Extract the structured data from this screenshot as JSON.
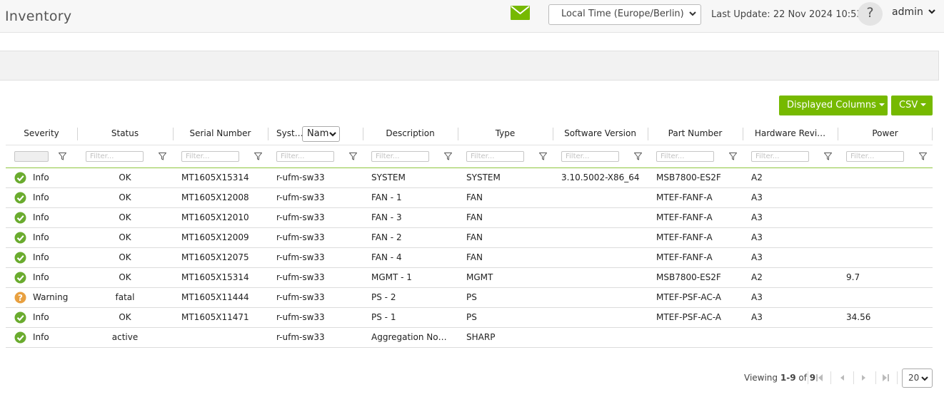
{
  "header": {
    "title": "Inventory",
    "timezone": "Local Time (Europe/Berlin)",
    "last_update_label": "Last Update:",
    "last_update_value": "22 Nov 2024 10:53",
    "help_symbol": "?",
    "user": "admin",
    "icons": [
      "mail-icon",
      "chevron-down-icon"
    ]
  },
  "toolbar": {
    "displayed_columns_label": "Displayed Columns",
    "csv_label": "CSV"
  },
  "colors": {
    "accent": "#76b900",
    "info": "#6aab2e",
    "warning": "#e8a040"
  },
  "table": {
    "columns": [
      "Severity",
      "Status",
      "Serial Number",
      "Syst…",
      "Description",
      "Type",
      "Software Version",
      "Part Number",
      "Hardware Revi…",
      "Power"
    ],
    "system_selector_value": "Nam",
    "filter_placeholder": "Filter...",
    "rows": [
      {
        "severity": "Info",
        "status": "OK",
        "serial": "MT1605X15314",
        "system": "r-ufm-sw33",
        "description": "SYSTEM",
        "type": "SYSTEM",
        "sw_version": "3.10.5002-X86_64",
        "part_number": "MSB7800-ES2F",
        "hw_rev": "A2",
        "power": ""
      },
      {
        "severity": "Info",
        "status": "OK",
        "serial": "MT1605X12008",
        "system": "r-ufm-sw33",
        "description": "FAN - 1",
        "type": "FAN",
        "sw_version": "",
        "part_number": "MTEF-FANF-A",
        "hw_rev": "A3",
        "power": ""
      },
      {
        "severity": "Info",
        "status": "OK",
        "serial": "MT1605X12010",
        "system": "r-ufm-sw33",
        "description": "FAN - 3",
        "type": "FAN",
        "sw_version": "",
        "part_number": "MTEF-FANF-A",
        "hw_rev": "A3",
        "power": ""
      },
      {
        "severity": "Info",
        "status": "OK",
        "serial": "MT1605X12009",
        "system": "r-ufm-sw33",
        "description": "FAN - 2",
        "type": "FAN",
        "sw_version": "",
        "part_number": "MTEF-FANF-A",
        "hw_rev": "A3",
        "power": ""
      },
      {
        "severity": "Info",
        "status": "OK",
        "serial": "MT1605X12075",
        "system": "r-ufm-sw33",
        "description": "FAN - 4",
        "type": "FAN",
        "sw_version": "",
        "part_number": "MTEF-FANF-A",
        "hw_rev": "A3",
        "power": ""
      },
      {
        "severity": "Info",
        "status": "OK",
        "serial": "MT1605X15314",
        "system": "r-ufm-sw33",
        "description": "MGMT - 1",
        "type": "MGMT",
        "sw_version": "",
        "part_number": "MSB7800-ES2F",
        "hw_rev": "A2",
        "power": "9.7"
      },
      {
        "severity": "Warning",
        "status": "fatal",
        "serial": "MT1605X11444",
        "system": "r-ufm-sw33",
        "description": "PS - 2",
        "type": "PS",
        "sw_version": "",
        "part_number": "MTEF-PSF-AC-A",
        "hw_rev": "A3",
        "power": ""
      },
      {
        "severity": "Info",
        "status": "OK",
        "serial": "MT1605X11471",
        "system": "r-ufm-sw33",
        "description": "PS - 1",
        "type": "PS",
        "sw_version": "",
        "part_number": "MTEF-PSF-AC-A",
        "hw_rev": "A3",
        "power": "34.56"
      },
      {
        "severity": "Info",
        "status": "active",
        "serial": "",
        "system": "r-ufm-sw33",
        "description": "Aggregation Nod…",
        "type": "SHARP",
        "sw_version": "",
        "part_number": "",
        "hw_rev": "",
        "power": ""
      }
    ]
  },
  "pagination": {
    "viewing_label": "Viewing",
    "range": "1-9",
    "of_label": "of",
    "total": "9",
    "page_size": "20"
  }
}
